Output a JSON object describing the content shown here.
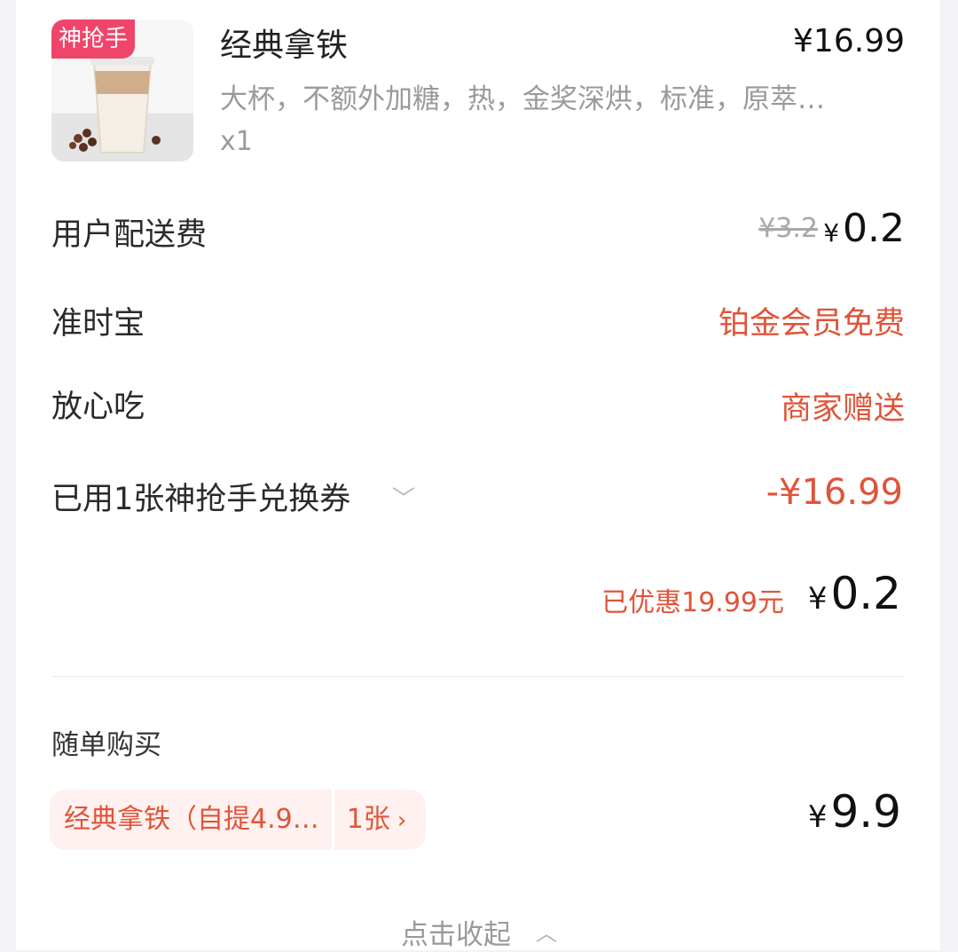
{
  "product": {
    "badge": "神抢手",
    "name": "经典拿铁",
    "price": "¥16.99",
    "specs": "大杯，不额外加糖，热，金奖深烘，标准，原萃…",
    "quantity": "x1"
  },
  "fees": {
    "delivery_label": "用户配送费",
    "delivery_original": "¥3.2",
    "delivery_yen": "¥",
    "delivery_price": "0.2",
    "ontime_label": "准时宝",
    "ontime_value": "铂金会员免费",
    "safe_label": "放心吃",
    "safe_value": "商家赠送"
  },
  "coupon": {
    "label": "已用1张神抢手兑换券",
    "amount": "-¥16.99"
  },
  "summary": {
    "saved": "已优惠19.99元",
    "yen": "¥",
    "total": "0.2"
  },
  "addon": {
    "title": "随单购买",
    "item_name": "经典拿铁（自提4.9…",
    "item_count": "1张",
    "yen": "¥",
    "price": "9.9"
  },
  "footer": {
    "collapse_label": "点击收起"
  },
  "colors": {
    "accent_red": "#e0543a",
    "badge_pink": "#f0456a"
  }
}
